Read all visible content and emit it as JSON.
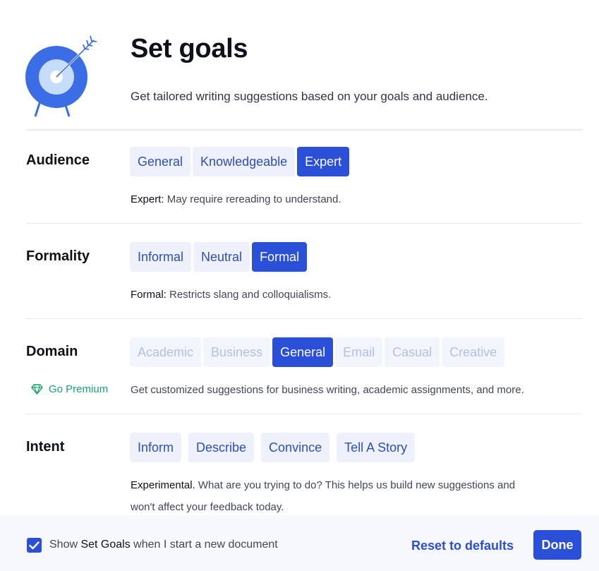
{
  "header": {
    "title": "Set goals",
    "subtitle": "Get tailored writing suggestions based on your goals and audience."
  },
  "audience": {
    "label": "Audience",
    "options": [
      "General",
      "Knowledgeable",
      "Expert"
    ],
    "selected": "Expert",
    "desc_key": "Expert:",
    "desc_text": " May require rereading to understand."
  },
  "formality": {
    "label": "Formality",
    "options": [
      "Informal",
      "Neutral",
      "Formal"
    ],
    "selected": "Formal",
    "desc_key": "Formal:",
    "desc_text": " Restricts slang and colloquialisms."
  },
  "domain": {
    "label": "Domain",
    "options": [
      "Academic",
      "Business",
      "General",
      "Email",
      "Casual",
      "Creative"
    ],
    "selected": "General",
    "premium_label": "Go Premium",
    "desc_text": "Get customized suggestions for business writing, academic assignments, and more."
  },
  "intent": {
    "label": "Intent",
    "options": [
      "Inform",
      "Describe",
      "Convince",
      "Tell A Story"
    ],
    "desc_key": "Experimental.",
    "desc_line1": " What are you trying to do? This helps us build new suggestions and",
    "desc_line2": "won't affect your feedback today."
  },
  "footer": {
    "checkbox_checked": true,
    "check_prefix": "Show ",
    "check_strong": "Set Goals",
    "check_suffix": " when I start a new document",
    "reset_label": "Reset to defaults",
    "done_label": "Done"
  },
  "colors": {
    "accent": "#2a4fd8",
    "premium": "#15a36e"
  },
  "icons": {
    "logo": "target-arrow-icon",
    "premium": "diamond-icon",
    "checkbox": "checkmark-icon"
  }
}
